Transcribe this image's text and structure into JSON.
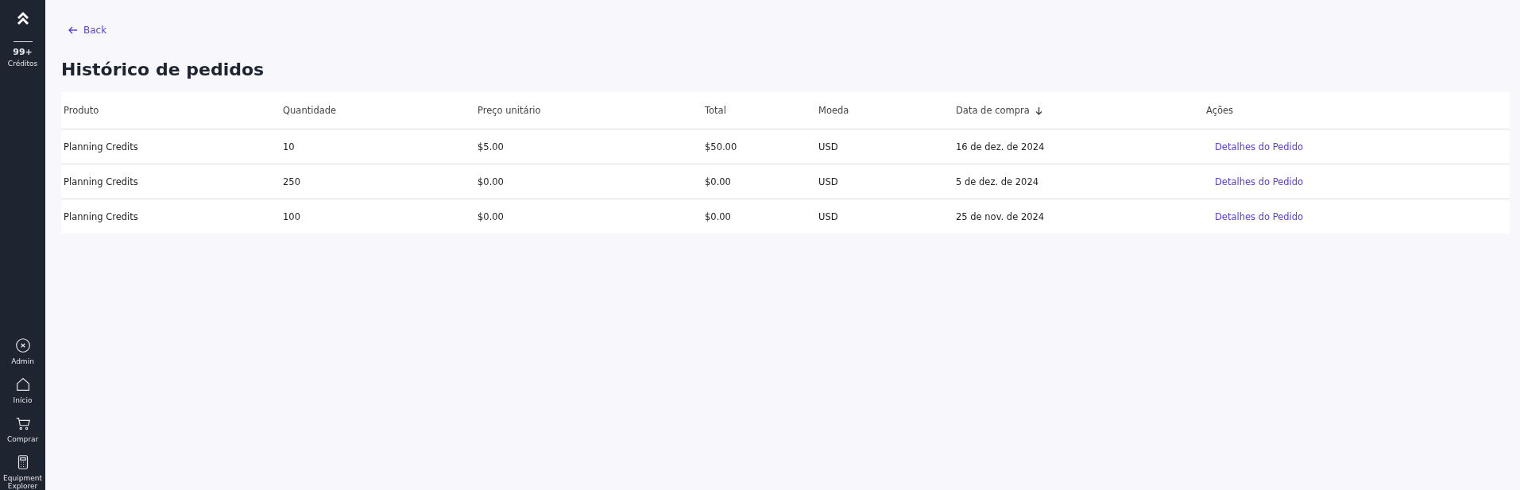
{
  "sidebar": {
    "credits": {
      "count": "99+",
      "label": "Créditos"
    },
    "items": [
      {
        "label": "Admin"
      },
      {
        "label": "Início"
      },
      {
        "label": "Comprar"
      },
      {
        "label": "Equipment Explorer"
      }
    ]
  },
  "back": {
    "label": "Back"
  },
  "title": "Histórico de pedidos",
  "table": {
    "columns": [
      {
        "label": "Produto",
        "sorted_descending": false
      },
      {
        "label": "Quantidade",
        "sorted_descending": false
      },
      {
        "label": "Preço unitário",
        "sorted_descending": false
      },
      {
        "label": "Total",
        "sorted_descending": false
      },
      {
        "label": "Moeda",
        "sorted_descending": false
      },
      {
        "label": "Data de compra",
        "sorted_descending": true
      },
      {
        "label": "Ações",
        "sorted_descending": false
      }
    ],
    "rows": [
      {
        "cells": [
          "Planning Credits",
          "10",
          "$5.00",
          "$50.00",
          "USD",
          "16 de dez. de 2024"
        ],
        "action": "Detalhes do Pedido"
      },
      {
        "cells": [
          "Planning Credits",
          "250",
          "$0.00",
          "$0.00",
          "USD",
          "5 de dez. de 2024"
        ],
        "action": "Detalhes do Pedido"
      },
      {
        "cells": [
          "Planning Credits",
          "100",
          "$0.00",
          "$0.00",
          "USD",
          "25 de nov. de 2024"
        ],
        "action": "Detalhes do Pedido"
      }
    ]
  }
}
